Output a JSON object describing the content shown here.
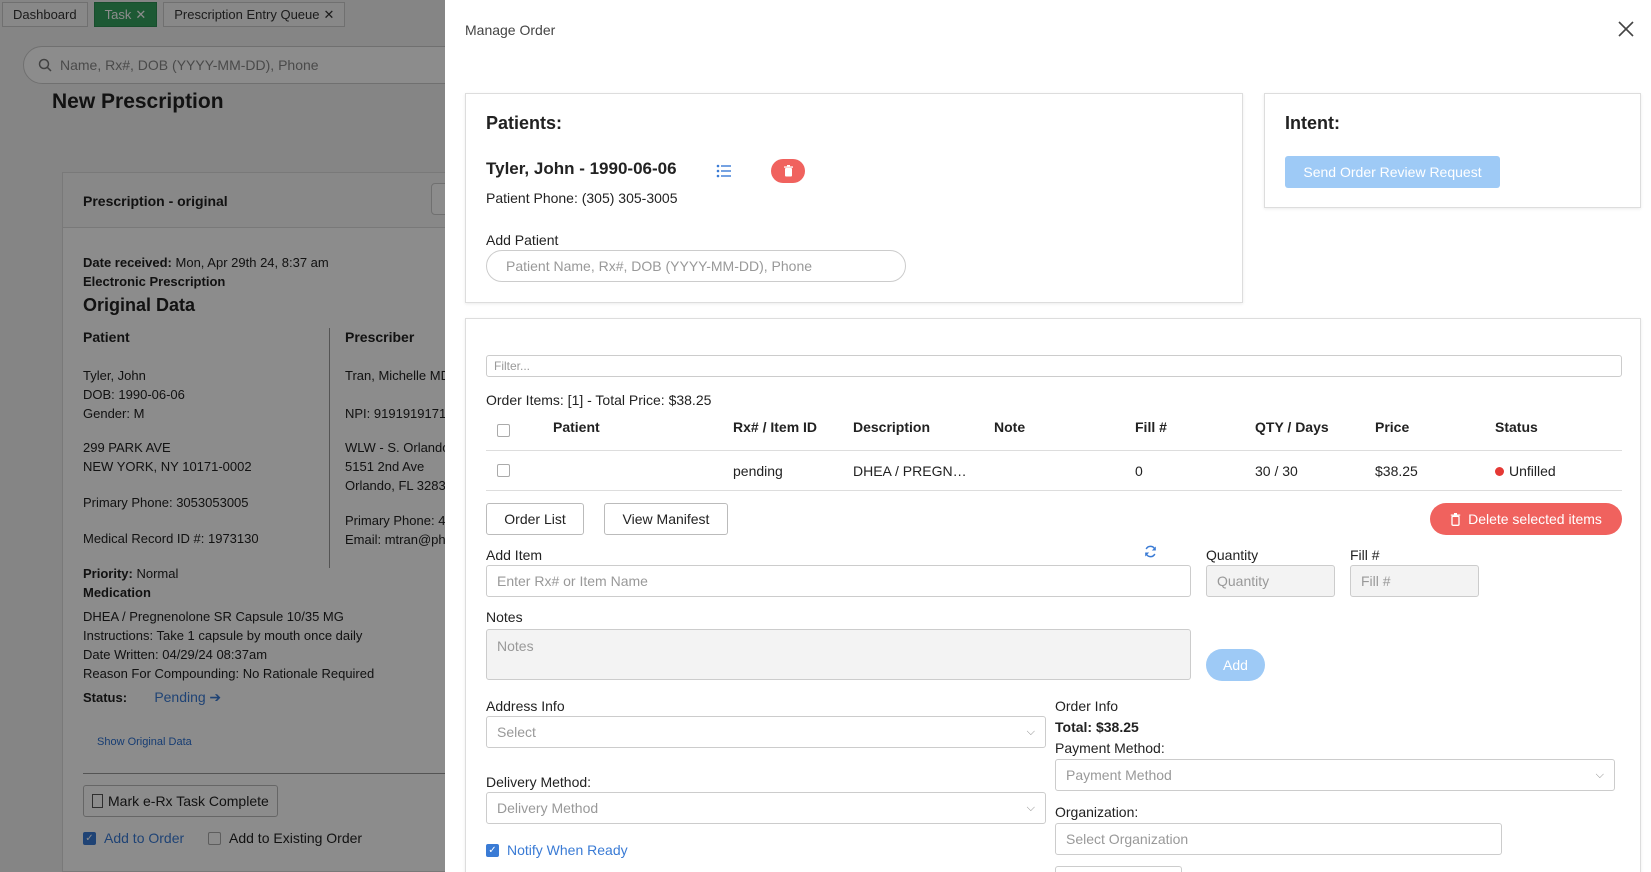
{
  "background": {
    "tabs": [
      {
        "label": "Dashboard"
      },
      {
        "label": "Task"
      },
      {
        "label": "Prescription Entry Queue"
      }
    ],
    "search_placeholder": "Name, Rx#, DOB (YYYY-MM-DD), Phone",
    "page_title": "New Prescription",
    "card_title": "Prescription - original",
    "date_received_label": "Date received:",
    "date_received_value": "Mon, Apr 29th 24, 8:37 am",
    "electronic": "Electronic Prescription",
    "original_data": "Original Data",
    "patient_heading": "Patient",
    "prescriber_heading": "Prescriber",
    "patient_name": "Tyler, John",
    "patient_dob": "DOB: 1990-06-06",
    "patient_gender": "Gender: M",
    "patient_addr1": "299 PARK AVE",
    "patient_addr2": "NEW YORK, NY 10171-0002",
    "patient_phone": "Primary Phone: 3053053005",
    "patient_mrid": "Medical Record ID #: 1973130",
    "prescriber_name": "Tran, Michelle MD",
    "prescriber_npi": "NPI: 9191919171",
    "prescriber_org": "WLW - S. Orlando",
    "prescriber_addr1": "5151 2nd Ave",
    "prescriber_addr2": "Orlando, FL 3283",
    "prescriber_phone": "Primary Phone: 4",
    "prescriber_email": "Email: mtran@ph",
    "priority_label": "Priority:",
    "priority_value": "Normal",
    "medication_label": "Medication",
    "med_name": "DHEA / Pregnenolone SR Capsule 10/35 MG",
    "instructions": "Instructions: Take 1 capsule by mouth once daily",
    "date_written": "Date Written: 04/29/24 08:37am",
    "reason": "Reason For Compounding: No Rationale Required",
    "status_label": "Status:",
    "status_value": "Pending",
    "show_original": "Show Original Data",
    "mark_task": "Mark e-Rx Task Complete",
    "add_to_order": "Add to Order",
    "add_to_existing": "Add to Existing Order"
  },
  "modal": {
    "title": "Manage Order",
    "patients_label": "Patients:",
    "patient_entry": "Tyler, John - 1990-06-06",
    "patient_phone": "Patient Phone: (305) 305-3005",
    "add_patient_label": "Add Patient",
    "add_patient_placeholder": "Patient Name, Rx#, DOB (YYYY-MM-DD), Phone",
    "intent_label": "Intent:",
    "send_review": "Send Order Review Request",
    "filter_placeholder": "Filter...",
    "order_items_summary": "Order Items: [1] - Total Price: $38.25",
    "table_headers": {
      "patient": "Patient",
      "rx": "Rx# / Item ID",
      "description": "Description",
      "note": "Note",
      "fill": "Fill #",
      "qty": "QTY / Days",
      "price": "Price",
      "status": "Status"
    },
    "row": {
      "patient": "",
      "rx": "pending",
      "description": "DHEA / PREGN…",
      "note": "",
      "fill": "0",
      "qty": "30 / 30",
      "price": "$38.25",
      "status": "Unfilled"
    },
    "order_list": "Order List",
    "view_manifest": "View Manifest",
    "delete_selected": "Delete selected items",
    "add_item_label": "Add Item",
    "add_item_placeholder": "Enter Rx# or Item Name",
    "quantity_label": "Quantity",
    "quantity_placeholder": "Quantity",
    "fill_label": "Fill #",
    "fill_placeholder": "Fill #",
    "notes_label": "Notes",
    "notes_placeholder": "Notes",
    "add_button": "Add",
    "address_info_label": "Address Info",
    "address_placeholder": "Select",
    "delivery_label": "Delivery Method:",
    "delivery_placeholder": "Delivery Method",
    "notify_label": "Notify When Ready",
    "order_info_label": "Order Info",
    "order_total": "Total: $38.25",
    "payment_label": "Payment Method:",
    "payment_placeholder": "Payment Method",
    "organization_label": "Organization:",
    "organization_placeholder": "Select Organization"
  },
  "colors": {
    "delete_red": "#f0625e",
    "status_red": "#e53935",
    "send_blue_disabled": "#9ecaf6",
    "task_green": "#35a35f",
    "link_blue": "#3a7bd5"
  }
}
